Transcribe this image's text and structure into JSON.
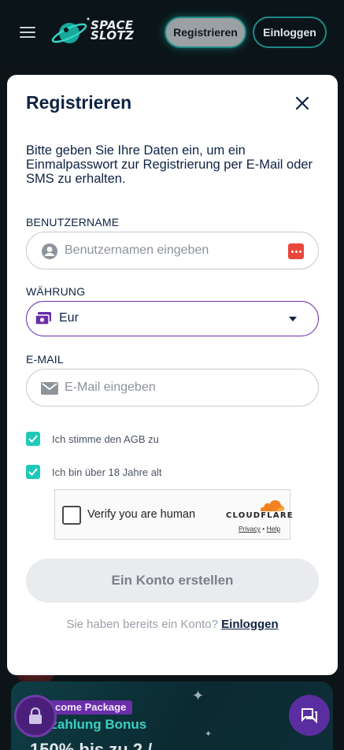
{
  "header": {
    "logo_line1": "SPACE",
    "logo_line2": "SLOTZ",
    "register_label": "Registrieren",
    "login_label": "Einloggen"
  },
  "modal": {
    "title": "Registrieren",
    "intro": "Bitte geben Sie Ihre Daten ein, um ein Einmalpasswort zur Registrierung per E-Mail oder SMS zu erhalten.",
    "username": {
      "label": "BENUTZERNAME",
      "placeholder": "Benutzernamen eingeben",
      "value": ""
    },
    "currency": {
      "label": "WÄHRUNG",
      "selected": "Eur"
    },
    "email": {
      "label": "E-MAIL",
      "placeholder": "E-Mail eingeben",
      "value": ""
    },
    "checks": [
      {
        "label": "Ich stimme den AGB zu",
        "checked": true
      },
      {
        "label": "Ich bin über 18 Jahre alt",
        "checked": true
      }
    ],
    "captcha": {
      "text": "Verify you are human",
      "brand": "CLOUDFLARE",
      "privacy": "Privacy",
      "separator": "•",
      "help": "Help"
    },
    "submit_label": "Ein Konto erstellen",
    "have_account_text": "Sie haben bereits ein Konto?",
    "login_link": "Einloggen"
  },
  "promo": {
    "badge": "come Package",
    "title": "nzahlung Bonus",
    "subtitle": "150% bis zu 2 /"
  },
  "colors": {
    "accent_teal": "#1fc9b8",
    "accent_purple": "#6a2ea8",
    "text_dark": "#0f2244",
    "background_dark": "#0c1418"
  }
}
